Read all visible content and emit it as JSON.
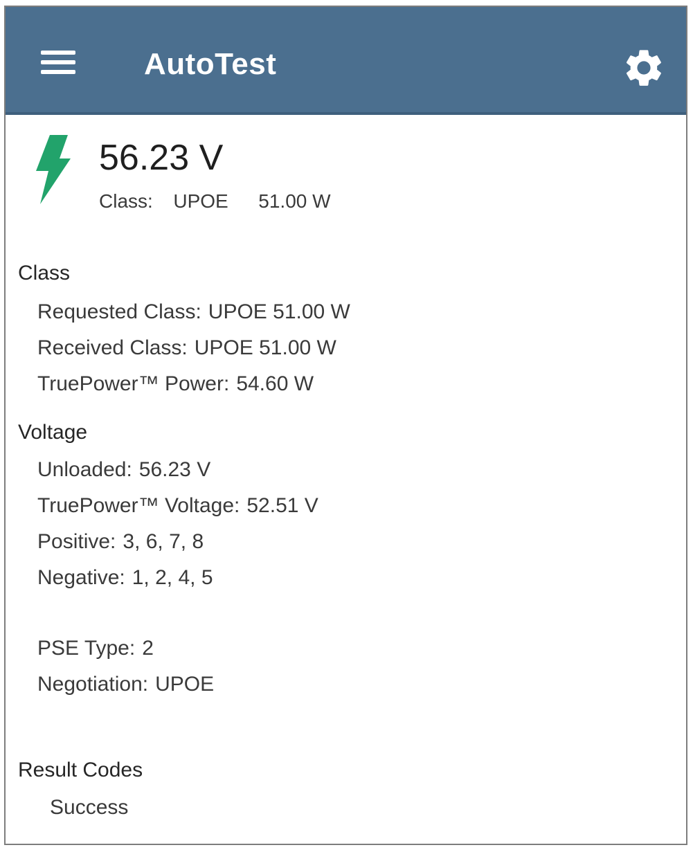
{
  "appbar": {
    "title": "AutoTest",
    "menu_icon": "hamburger-menu-icon",
    "settings_icon": "gear-icon",
    "background_color": "#4b6f8f"
  },
  "summary": {
    "icon": "lightning-bolt-icon",
    "icon_color": "#22a36b",
    "voltage": "56.23 V",
    "class_label": "Class:",
    "class_type": "UPOE",
    "class_power": "51.00 W"
  },
  "class_section": {
    "title": "Class",
    "rows": [
      {
        "label": "Requested Class:",
        "value": "UPOE 51.00 W"
      },
      {
        "label": "Received Class:",
        "value": "UPOE 51.00 W"
      },
      {
        "label": "TruePower™ Power:",
        "value": "54.60 W"
      }
    ]
  },
  "voltage_section": {
    "title": "Voltage",
    "rows": [
      {
        "label": "Unloaded:",
        "value": "56.23 V"
      },
      {
        "label": "TruePower™ Voltage:",
        "value": "52.51 V"
      },
      {
        "label": "Positive:",
        "value": "3, 6, 7, 8"
      },
      {
        "label": "Negative:",
        "value": "1, 2, 4, 5"
      }
    ]
  },
  "pse": {
    "rows": [
      {
        "label": "PSE Type:",
        "value": "2"
      },
      {
        "label": "Negotiation:",
        "value": "UPOE"
      }
    ]
  },
  "result_codes": {
    "title": "Result Codes",
    "value": "Success"
  }
}
